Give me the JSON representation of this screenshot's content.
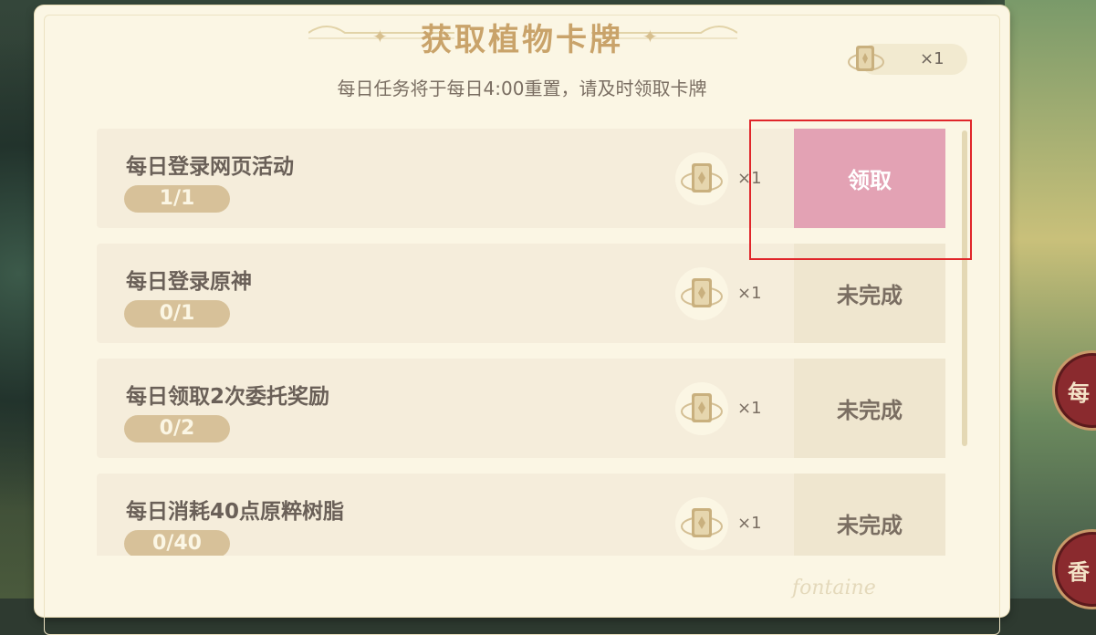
{
  "title": "获取植物卡牌",
  "subtitle": "每日任务将于每日4:00重置，请及时领取卡牌",
  "card_count": "×1",
  "tasks": [
    {
      "name": "每日登录网页活动",
      "progress": "1/1",
      "reward": "×1",
      "action": "领取",
      "claimable": true
    },
    {
      "name": "每日登录原神",
      "progress": "0/1",
      "reward": "×1",
      "action": "未完成",
      "claimable": false
    },
    {
      "name": "每日领取2次委托奖励",
      "progress": "0/2",
      "reward": "×1",
      "action": "未完成",
      "claimable": false
    },
    {
      "name": "每日消耗40点原粹树脂",
      "progress": "0/40",
      "reward": "×1",
      "action": "未完成",
      "claimable": false
    }
  ],
  "side_buttons": [
    "每",
    "香"
  ],
  "watermark": "fontaine",
  "colors": {
    "accent_title": "#c9a36a",
    "claim_button": "#e3a2b4",
    "highlight_box": "#e0262a",
    "panel_bg": "#fbf6e4"
  },
  "icons": [
    "card-icon",
    "star-ornament-icon"
  ]
}
